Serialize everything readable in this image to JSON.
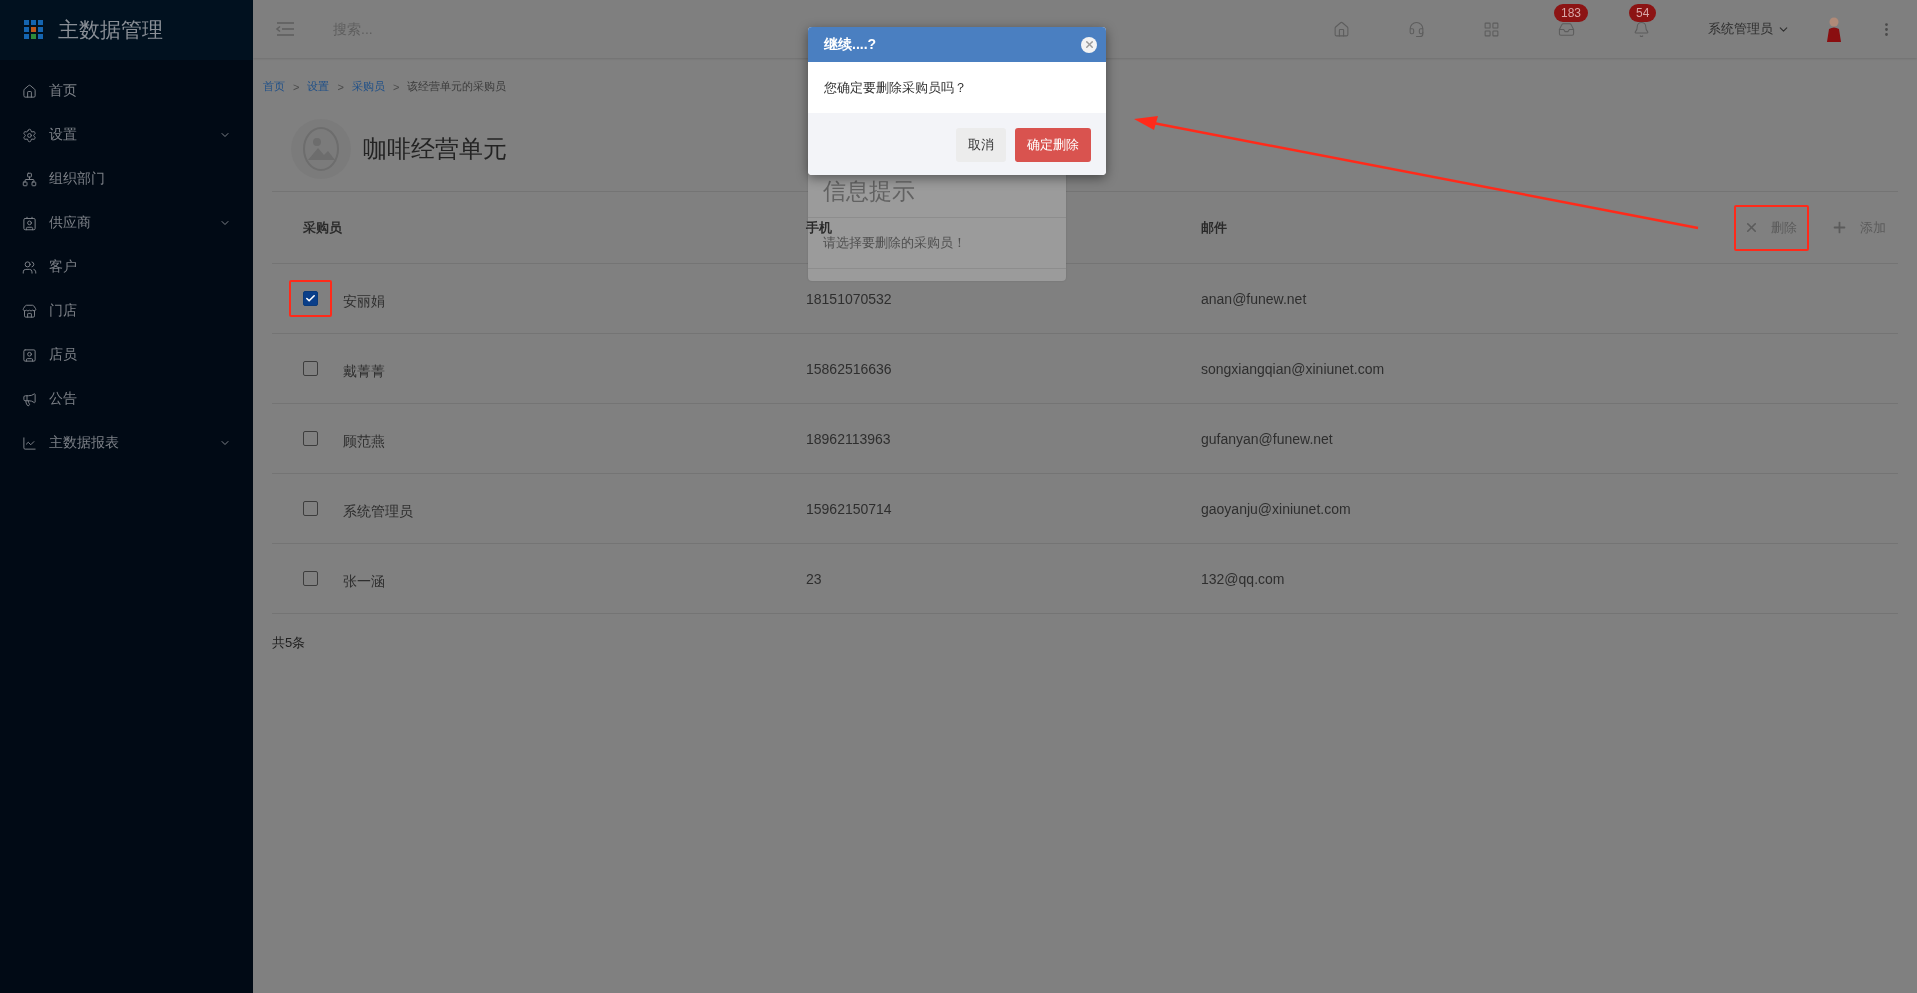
{
  "sidebar": {
    "logo": "主数据管理",
    "items": [
      {
        "label": "首页",
        "expandable": false
      },
      {
        "label": "设置",
        "expandable": true
      },
      {
        "label": "组织部门",
        "expandable": false
      },
      {
        "label": "供应商",
        "expandable": true
      },
      {
        "label": "客户",
        "expandable": false
      },
      {
        "label": "门店",
        "expandable": false
      },
      {
        "label": "店员",
        "expandable": false
      },
      {
        "label": "公告",
        "expandable": false
      },
      {
        "label": "主数据报表",
        "expandable": true
      }
    ]
  },
  "topbar": {
    "search": {
      "placeholder": "搜索..."
    },
    "counts": [
      "183",
      "54"
    ],
    "user": "系统管理员"
  },
  "breadcrumb": [
    {
      "kind": "link",
      "text": "首页"
    },
    {
      "kind": "separator",
      "text": ">"
    },
    {
      "kind": "link",
      "text": "设置"
    },
    {
      "kind": "separator",
      "text": ">"
    },
    {
      "kind": "link",
      "text": "采购员"
    },
    {
      "kind": "separator",
      "text": ">"
    },
    {
      "kind": "current",
      "text": "该经营单元的采购员"
    }
  ],
  "title": "咖啡经营单元",
  "table": {
    "columns": [
      "采购员",
      "手机",
      "邮件"
    ],
    "actions": [
      {
        "kind": "delete",
        "label": "删除",
        "highlighted": true
      },
      {
        "kind": "add",
        "label": "添加",
        "highlighted": false
      }
    ],
    "rows": [
      {
        "checked": true,
        "highlighted": true,
        "name": "安丽娟",
        "phone": "18151070532",
        "email": "anan@funew.net"
      },
      {
        "checked": false,
        "highlighted": false,
        "name": "戴菁菁",
        "phone": "15862516636",
        "email": "songxiangqian@xiniunet.com"
      },
      {
        "checked": false,
        "highlighted": false,
        "name": "顾范燕",
        "phone": "18962113963",
        "email": "gufanyan@funew.net"
      },
      {
        "checked": false,
        "highlighted": false,
        "name": "系统管理员",
        "phone": "15962150714",
        "email": "gaoyanju@xiniunet.com"
      },
      {
        "checked": false,
        "highlighted": false,
        "name": "张一涵",
        "phone": "23",
        "email": "132@qq.com"
      }
    ]
  },
  "total": "共5条",
  "toast": {
    "title": "信息提示",
    "message": "请选择要删除的采购员！"
  },
  "dialog": {
    "title": "继续....?",
    "message": "您确定要删除采购员吗？",
    "buttons": [
      {
        "kind": "secondary",
        "label": "取消"
      },
      {
        "kind": "danger",
        "label": "确定删除"
      }
    ]
  }
}
